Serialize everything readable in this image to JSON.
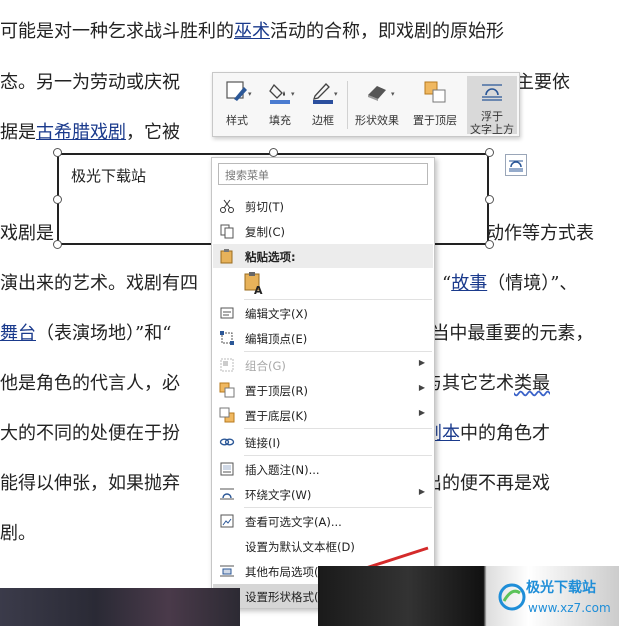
{
  "document": {
    "line1": {
      "a": "可能是对一种乞求战斗胜利的",
      "link": "巫术",
      "b": "活动的合称，即戏剧的原始形"
    },
    "line2": {
      "a": "态。另一为劳动或庆祝",
      "b": "法主要依"
    },
    "line3": {
      "a": "据是",
      "link": "古希腊戏剧",
      "b": "，它被"
    },
    "line4": {
      "a": "戏剧是",
      "b": "动作等方式表"
    },
    "line5": {
      "a": "演出来的艺术。戏剧有四",
      "q1": "、“",
      "link": "故事",
      "b": "（情境）”、"
    },
    "line6": {
      "link": "舞台",
      "a": "（表演场地）”和“",
      "b": "当中最重要的元素，"
    },
    "line7": {
      "a": "他是角色的代言人，必",
      "b": "剧与其它艺术",
      "wavy": "类最"
    },
    "line8": {
      "a": "大的不同的处便在于扮",
      "b": "，",
      "link": "剧本",
      "c": "中的角色才"
    },
    "line9": {
      "a": "能得以伸张，如果抛弃",
      "b": "演出的便不再是戏"
    },
    "line10": {
      "a": "剧。"
    }
  },
  "shape": {
    "text": "极光下载站"
  },
  "mini_toolbar": {
    "style": "样式",
    "fill": "填充",
    "outline": "边框",
    "shape_effects": "形状效果",
    "bring_to_front": "置于顶层",
    "float_line1": "浮于",
    "float_line2": "文字上方"
  },
  "context_menu": {
    "search_placeholder": "搜索菜单",
    "items": [
      {
        "label": "剪切(T)",
        "icon": "scissors-icon"
      },
      {
        "label": "复制(C)",
        "icon": "copy-icon"
      },
      {
        "label": "粘贴选项:",
        "icon": "paste-icon"
      },
      {
        "label": "编辑文字(X)",
        "icon": "edit-text-icon"
      },
      {
        "label": "编辑顶点(E)",
        "icon": "edit-points-icon"
      },
      {
        "label": "组合(G)",
        "icon": "group-icon"
      },
      {
        "label": "置于顶层(R)",
        "icon": "bring-front-icon"
      },
      {
        "label": "置于底层(K)",
        "icon": "send-back-icon"
      },
      {
        "label": "链接(I)",
        "icon": "link-icon"
      },
      {
        "label": "插入题注(N)...",
        "icon": "caption-icon"
      },
      {
        "label": "环绕文字(W)",
        "icon": "wrap-text-icon"
      },
      {
        "label": "查看可选文字(A)...",
        "icon": "alt-text-icon"
      },
      {
        "label": "设置为默认文本框(D)",
        "icon": ""
      },
      {
        "label": "其他布局选项(L)...",
        "icon": "layout-icon"
      },
      {
        "label": "设置形状格式(O)...",
        "icon": "format-shape-icon"
      }
    ]
  },
  "watermark": {
    "text": "极光下载站",
    "sub": "www.xz7.com"
  },
  "colors": {
    "link": "#1a3a8c",
    "menu_hover": "#d6d6d6",
    "arrow": "#d42a2a",
    "watermark": "#1f8ed8"
  }
}
